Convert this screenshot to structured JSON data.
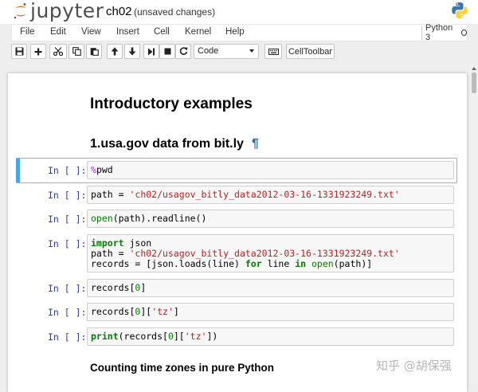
{
  "header": {
    "logo_text": "jupyter",
    "notebook_name": "ch02",
    "save_status": "(unsaved changes)"
  },
  "menubar": {
    "items": [
      "File",
      "Edit",
      "View",
      "Insert",
      "Cell",
      "Kernel",
      "Help"
    ],
    "kernel_name": "Python 3"
  },
  "toolbar": {
    "cell_type": "Code",
    "cell_toolbar_label": "CellToolbar",
    "icons": [
      "save-icon",
      "plus-icon",
      "scissors-icon",
      "copy-icon",
      "paste-icon",
      "arrow-up-icon",
      "arrow-down-icon",
      "skip-forward-icon",
      "stop-icon",
      "restart-icon",
      "keyboard-icon"
    ]
  },
  "notebook": {
    "title": "Introductory examples",
    "section": "1.usa.gov data from bit.ly",
    "anchor": "¶",
    "prompt": "In [ ]:",
    "subsection": "Counting time zones in pure Python"
  },
  "watermark": "知乎 @胡保强",
  "colors": {
    "selected_cell_border": "#42a5f5",
    "prompt": "#303f9f",
    "keyword": "#008000",
    "string": "#ba2121"
  }
}
